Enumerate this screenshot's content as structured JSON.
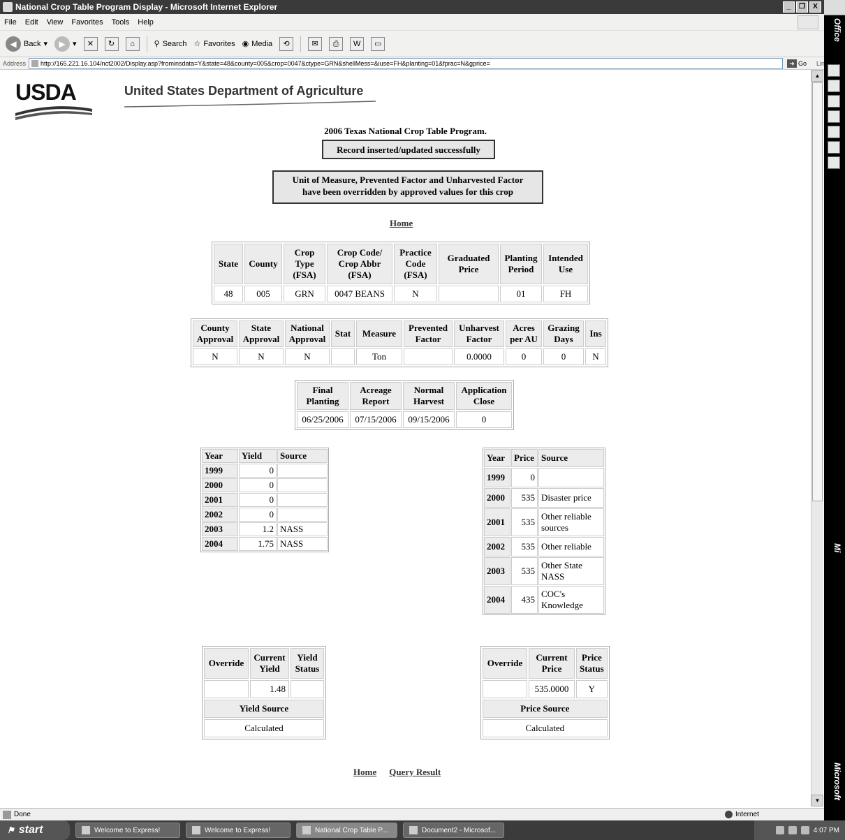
{
  "window": {
    "title": "National Crop Table Program Display - Microsoft Internet Explorer",
    "controls": [
      "_",
      "❐",
      "X"
    ]
  },
  "menu": [
    "File",
    "Edit",
    "View",
    "Favorites",
    "Tools",
    "Help"
  ],
  "toolbar": {
    "back": "Back",
    "search": "Search",
    "favorites": "Favorites",
    "media": "Media"
  },
  "address": {
    "label": "Address",
    "url": "http://165.221.16.104/nct2002/Display.asp?frominsdata=Y&state=48&county=005&crop=0047&ctype=GRN&shellMess=&iuse=FH&planting=01&fprac=N&gprice=",
    "go": "Go",
    "links": "Links"
  },
  "office_bar": {
    "top_label": "Office",
    "mid_label": "Mi",
    "bottom_label": "Microsoft"
  },
  "page": {
    "logo": "USDA",
    "dept_title": "United States Department of Agriculture",
    "program_title": "2006 Texas National Crop Table Program.",
    "inserted_msg": "Record inserted/updated successfully",
    "override_msg_line1": "Unit of Measure, Prevented Factor and Unharvested Factor",
    "override_msg_line2": "have been overridden by approved values for this crop",
    "home_link": "Home",
    "query_link": "Query Result"
  },
  "main_table": {
    "headers": [
      "State",
      "County",
      "Crop Type (FSA)",
      "Crop Code/ Crop Abbr (FSA)",
      "Practice Code (FSA)",
      "Graduated Price",
      "Planting Period",
      "Intended Use"
    ],
    "row": [
      "48",
      "005",
      "GRN",
      "0047 BEANS",
      "N",
      "",
      "01",
      "FH"
    ]
  },
  "approval_table": {
    "headers": [
      "County Approval",
      "State Approval",
      "National Approval",
      "Stat",
      "Measure",
      "Prevented Factor",
      "Unharvest Factor",
      "Acres per AU",
      "Grazing Days",
      "Ins"
    ],
    "row": [
      "N",
      "N",
      "N",
      "",
      "Ton",
      "",
      "0.0000",
      "0",
      "0",
      "N"
    ]
  },
  "dates_table": {
    "headers": [
      "Final Planting",
      "Acreage Report",
      "Normal Harvest",
      "Application Close"
    ],
    "row": [
      "06/25/2006",
      "07/15/2006",
      "09/15/2006",
      "0"
    ]
  },
  "yield_history": {
    "headers": [
      "Year",
      "Yield",
      "Source"
    ],
    "rows": [
      [
        "1999",
        "0",
        ""
      ],
      [
        "2000",
        "0",
        ""
      ],
      [
        "2001",
        "0",
        ""
      ],
      [
        "2002",
        "0",
        ""
      ],
      [
        "2003",
        "1.2",
        "NASS"
      ],
      [
        "2004",
        "1.75",
        "NASS"
      ]
    ]
  },
  "price_history": {
    "headers": [
      "Year",
      "Price",
      "Source"
    ],
    "rows": [
      [
        "1999",
        "0",
        ""
      ],
      [
        "2000",
        "535",
        "Disaster price"
      ],
      [
        "2001",
        "535",
        "Other reliable sources"
      ],
      [
        "2002",
        "535",
        "Other reliable"
      ],
      [
        "2003",
        "535",
        "Other State NASS"
      ],
      [
        "2004",
        "435",
        "COC's Knowledge"
      ]
    ]
  },
  "current_yield": {
    "headers": [
      "Override",
      "Current Yield",
      "Yield Status"
    ],
    "row": [
      "",
      "1.48",
      ""
    ],
    "source_label": "Yield Source",
    "source_value": "Calculated"
  },
  "current_price": {
    "headers": [
      "Override",
      "Current Price",
      "Price Status"
    ],
    "row": [
      "",
      "535.0000",
      "Y"
    ],
    "source_label": "Price Source",
    "source_value": "Calculated"
  },
  "status": {
    "left": "Done",
    "zone": "Internet"
  },
  "taskbar": {
    "start": "start",
    "items": [
      "Welcome to Express!",
      "Welcome to Express!",
      "National Crop Table P...",
      "Document2 - Microsof..."
    ],
    "clock": "4:07 PM"
  }
}
